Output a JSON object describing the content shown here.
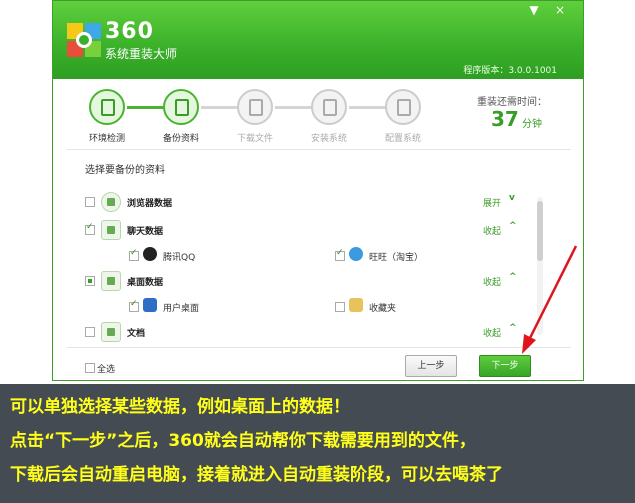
{
  "window": {
    "brand_number": "360",
    "brand_subtitle": "系统重装大师",
    "version": "程序版本：3.0.0.1001",
    "minimize_glyph": "▼",
    "close_glyph": "×"
  },
  "steps": [
    {
      "label": "环境检测",
      "state": "done",
      "icon": "monitor-icon"
    },
    {
      "label": "备份资料",
      "state": "active",
      "icon": "document-icon"
    },
    {
      "label": "下载文件",
      "state": "pending",
      "icon": "download-icon"
    },
    {
      "label": "安装系统",
      "state": "pending",
      "icon": "gear-icon"
    },
    {
      "label": "配置系统",
      "state": "pending",
      "icon": "windows-icon"
    }
  ],
  "time": {
    "label": "重装还需时间：",
    "value": "37",
    "unit": "分钟"
  },
  "section_title": "选择要备份的资料",
  "categories": [
    {
      "label": "浏览器数据",
      "toggle": "展开",
      "chevron": "v",
      "checked": false
    },
    {
      "label": "聊天数据",
      "toggle": "收起",
      "chevron": "^",
      "checked": true
    },
    {
      "label": "桌面数据",
      "toggle": "收起",
      "chevron": "^",
      "checked": "partial"
    },
    {
      "label": "文档",
      "toggle": "收起",
      "chevron": "^",
      "checked": false
    }
  ],
  "chat_items": [
    {
      "label": "腾讯QQ",
      "checked": true
    },
    {
      "label": "旺旺（淘宝）",
      "checked": true
    }
  ],
  "desktop_items": [
    {
      "label": "用户桌面",
      "checked": true
    },
    {
      "label": "收藏夹",
      "checked": false
    }
  ],
  "footer": {
    "select_all": "全选",
    "prev": "上一步",
    "next": "下一步"
  },
  "caption": {
    "line1": "可以单独选择某些数据，例如桌面上的数据！",
    "line2": "点击“下一步”之后，360就会自动帮你下载需要用到的文件，",
    "line3": "下载后会自动重启电脑，接着就进入自动重装阶段，可以去喝茶了"
  },
  "colors": {
    "brand_green": "#3ab02a",
    "accent_green": "#3a9d27",
    "caption_bg": "#444b52",
    "caption_text": "#ffff1a",
    "arrow_red": "#e0151b"
  }
}
